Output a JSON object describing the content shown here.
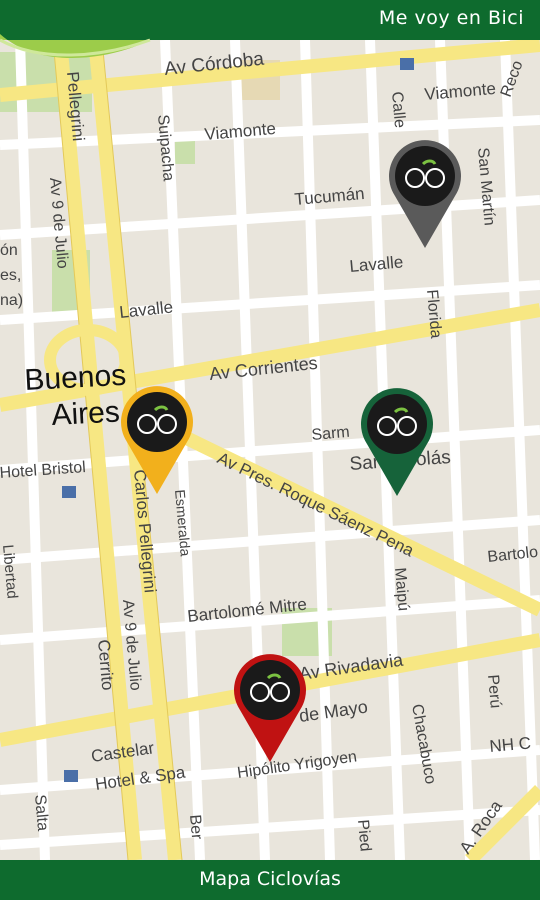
{
  "app": {
    "title": "Me voy en Bici",
    "footer_label": "Mapa Ciclovías"
  },
  "colors": {
    "bar": "#0e6b2e",
    "road_major": "#f7e783",
    "road_minor": "#ffffff",
    "block": "#e9e5dc",
    "park": "#c9dfab"
  },
  "map": {
    "streets": {
      "cordoba": "Av Córdoba",
      "viamonte_left": "Viamonte",
      "viamonte_right": "Viamonte",
      "suipacha": "Suipacha",
      "tucuman": "Tucumán",
      "lavalle_left": "Lavalle",
      "lavalle_right": "Lavalle",
      "corrientes": "Av Corrientes",
      "florida": "Florida",
      "san_martin": "San Martín",
      "calle": "Calle",
      "roque_saenz_pena": "Av Pres. Roque Sáenz Pena",
      "carlos_pellegrini": "Carlos Pellegrini",
      "pellegrini_top": "Pellegrini",
      "esmeralda": "Esmeralda",
      "av9dejulio_top": "Av 9 de Julio",
      "av9dejulio_bottom": "Av 9 de Julio",
      "bartolome_mitre": "Bartolomé Mitre",
      "bartolome_right": "Bartolo",
      "rivadavia": "Av Rivadavia",
      "de_mayo": "de Mayo",
      "hipolito": "Hipólito Yrigoyen",
      "chacabuco": "Chacabuco",
      "maipu": "Maipú",
      "peru": "Perú",
      "cerrito": "Cerrito",
      "salta": "Salta",
      "libertad": "Libertad",
      "bernardo": "Ber",
      "piedras": "Pied",
      "roca": "A. Roca",
      "sarmiento": "Sarm",
      "reconquista": "Reco"
    },
    "places": {
      "city_line1": "Buenos",
      "city_line2": "Aires",
      "san_nicolas": "San Nicolás",
      "hotel_bristol": "Hotel Bristol",
      "castelar_1": "Castelar",
      "castelar_2": "Hotel & Spa",
      "nh": "NH C",
      "left_fragment_1": "ón",
      "left_fragment_2": "es,",
      "left_fragment_3": "na)"
    },
    "markers": [
      {
        "id": "gray",
        "color": "#5a5a5a",
        "icon": "bicycle-icon"
      },
      {
        "id": "yellow",
        "color": "#f2b01c",
        "icon": "bicycle-icon"
      },
      {
        "id": "green",
        "color": "#16633a",
        "icon": "bicycle-icon"
      },
      {
        "id": "red",
        "color": "#c01212",
        "icon": "bicycle-icon"
      }
    ]
  }
}
